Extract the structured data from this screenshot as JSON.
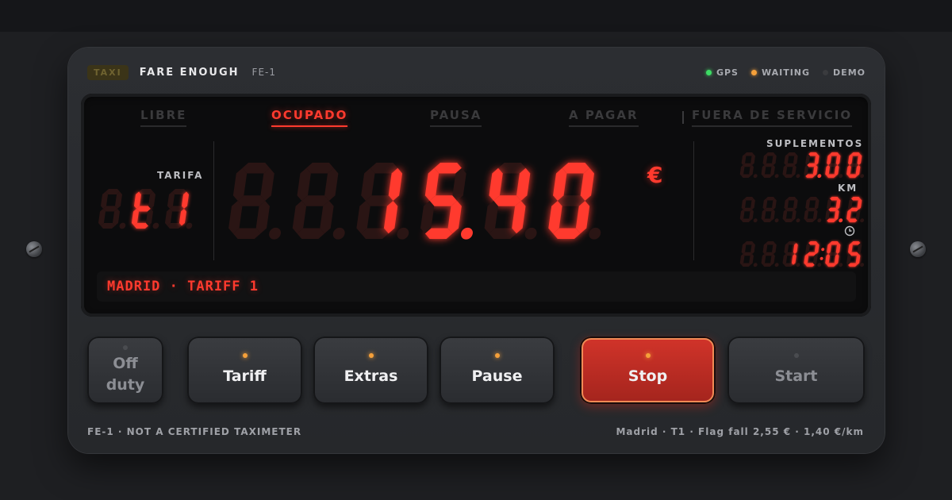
{
  "header": {
    "badge": "TAXI",
    "brand": "FARE ENOUGH",
    "model": "FE-1",
    "status": [
      {
        "label": "GPS",
        "color": "#3ddc64"
      },
      {
        "label": "WAITING",
        "color": "#f5a03a"
      },
      {
        "label": "DEMO",
        "color": "#3a3b3e"
      }
    ]
  },
  "tabs": [
    "LIBRE",
    "OCUPADO",
    "PAUSA",
    "A PAGAR",
    "FUERA DE SERVICIO"
  ],
  "active_tab": "OCUPADO",
  "tariff": {
    "label": "TARIFA",
    "display": "t1"
  },
  "fare": {
    "display": "15.40",
    "currency": "€"
  },
  "side": {
    "supplements_label": "SUPLEMENTOS",
    "supplements": "3.00",
    "km_label": "KM",
    "km": "3.2",
    "time_icon": "clock-icon",
    "time": "12:05"
  },
  "ticker": "MADRID · TARIFF 1",
  "buttons": [
    {
      "label": "Off duty",
      "led": "off",
      "enabled": false
    },
    {
      "label": "Tariff",
      "led": "on",
      "enabled": true
    },
    {
      "label": "Extras",
      "led": "on",
      "enabled": true
    },
    {
      "label": "Pause",
      "led": "on",
      "enabled": true
    },
    {
      "label": "Stop",
      "led": "on",
      "enabled": true
    },
    {
      "label": "Start",
      "led": "off",
      "enabled": false
    }
  ],
  "footer": {
    "left": "FE-1 · NOT A CERTIFIED TAXIMETER",
    "right": "Madrid · T1 · Flag fall 2,55 € · 1,40 €/km"
  },
  "colors": {
    "segment_on": "#ff3a2e",
    "segment_off": "#2a1514",
    "accent_stop": "#c62e24"
  }
}
